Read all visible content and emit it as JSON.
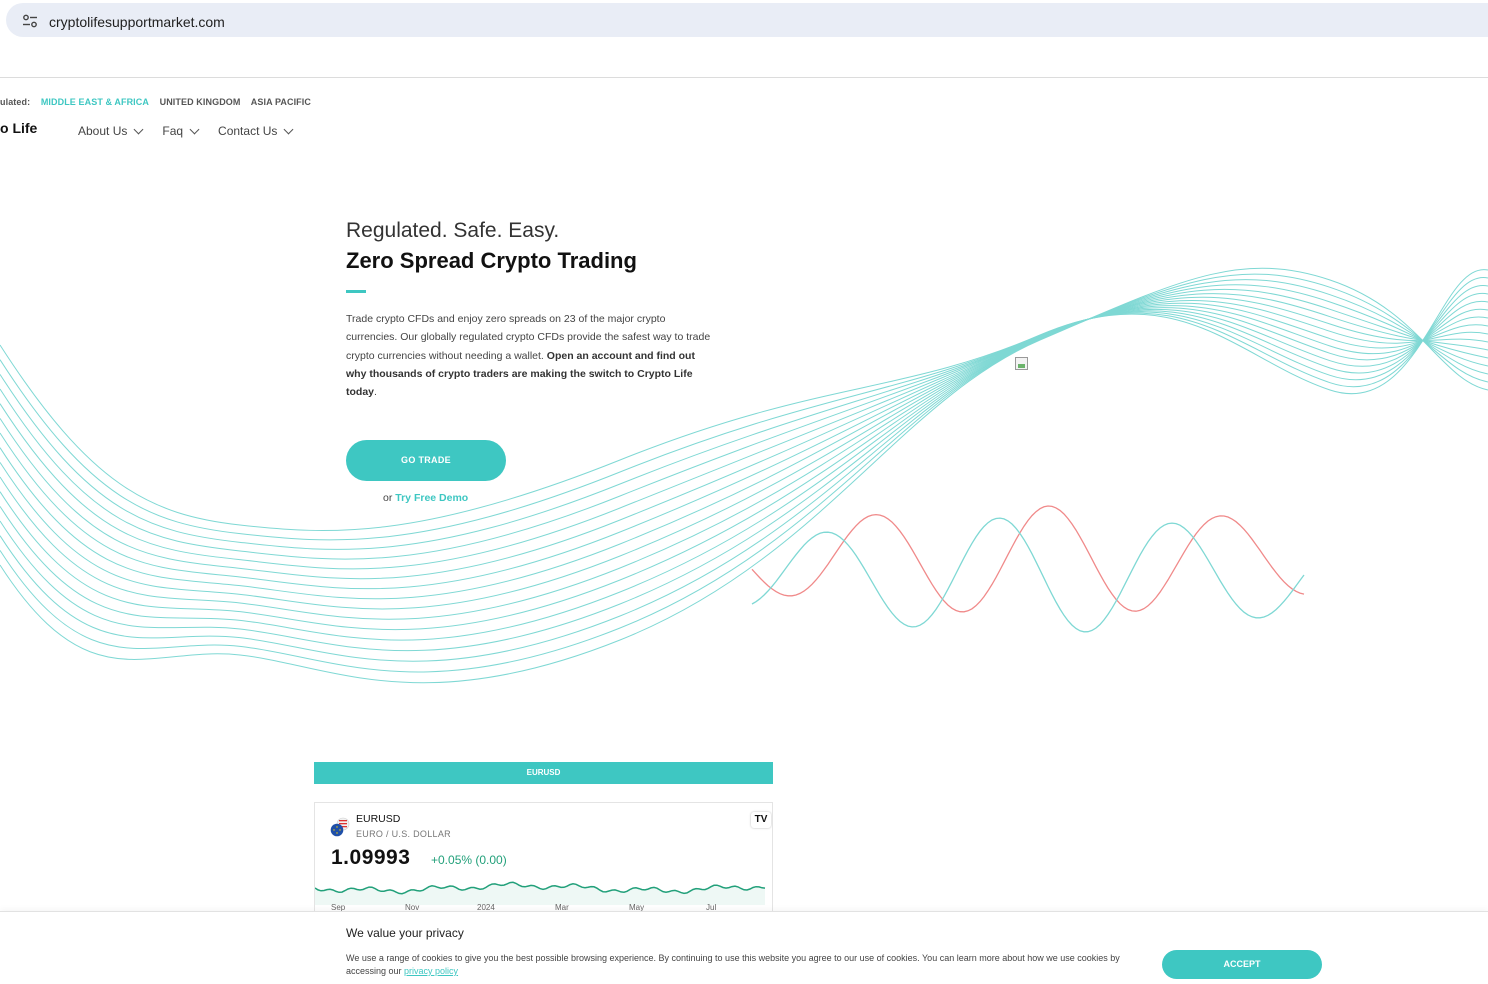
{
  "browser": {
    "url": "cryptolifesupportmarket.com",
    "icon": "site-settings-icon"
  },
  "regbar": {
    "label": "ulated:",
    "regions": [
      "MIDDLE EAST & AFRICA",
      "UNITED KINGDOM",
      "ASIA PACIFIC"
    ],
    "active_color": "#3ec7c2"
  },
  "brand": {
    "text": "o Life"
  },
  "nav": {
    "items": [
      "About Us",
      "Faq",
      "Contact Us"
    ]
  },
  "hero": {
    "subtitle": "Regulated. Safe. Easy.",
    "title": "Zero Spread Crypto Trading",
    "body_plain": "Trade crypto CFDs and enjoy zero spreads on 23 of the major crypto currencies. Our globally regulated crypto CFDs provide the safest way to trade crypto currencies without needing a wallet. ",
    "body_bold": "Open an account and find out why thousands of crypto traders are making the switch to Crypto Life today",
    "body_end": ".",
    "cta_label": "GO TRADE",
    "demo_prefix": "or ",
    "demo_link": "Try Free Demo"
  },
  "ticker": {
    "tab_label": "EURUSD",
    "symbol": "EURUSD",
    "description": "EURO / U.S. DOLLAR",
    "price": "1.09993",
    "change": "+0.05% (0.00)",
    "tv_logo": "TV",
    "months": [
      "Sep",
      "Nov",
      "2024",
      "Mar",
      "May",
      "Jul"
    ]
  },
  "cookie": {
    "title": "We value your privacy",
    "text": "We use a range of cookies to give you the best possible browsing experience. By continuing to use this website you agree to our use of cookies. You can learn more about how we use cookies by accessing our ",
    "link": "privacy policy",
    "accept": "ACCEPT"
  },
  "colors": {
    "accent": "#3ec7c2",
    "wave": "#7fd8d4",
    "wave_red": "#f08a8a",
    "chart_green": "#22a07a"
  }
}
